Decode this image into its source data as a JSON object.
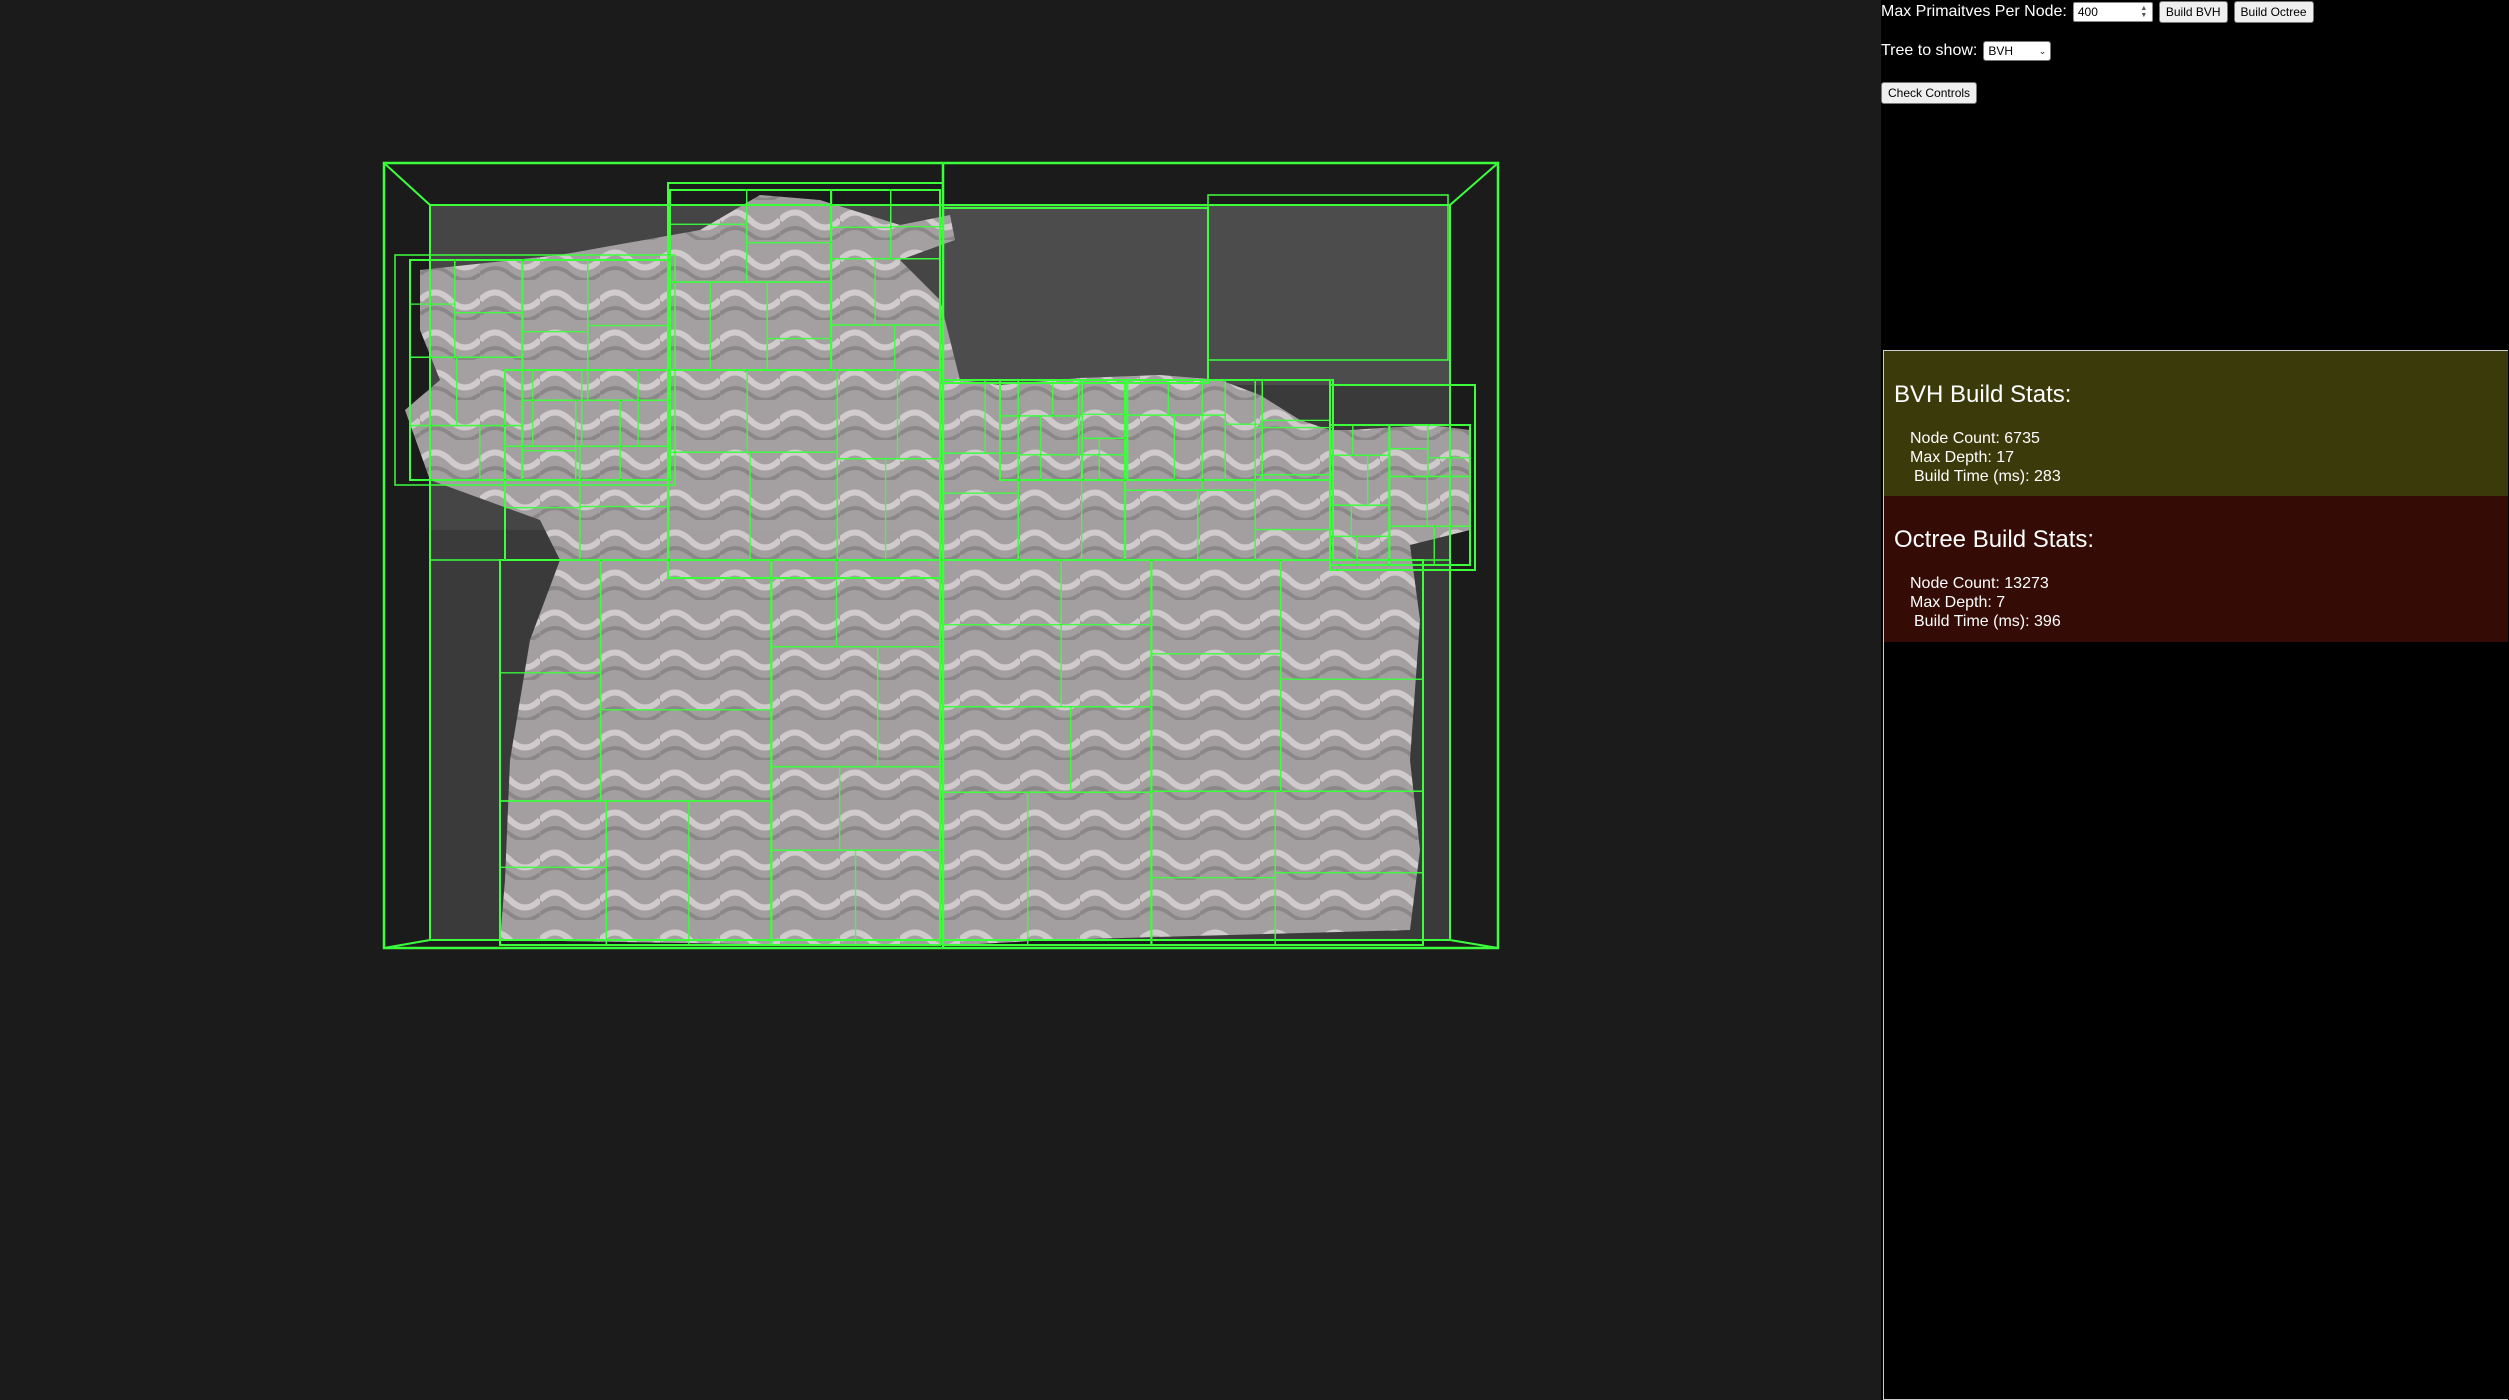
{
  "controls": {
    "max_prims_label": "Max Primaitves Per Node:",
    "max_prims_value": "400",
    "build_bvh_label": "Build BVH",
    "build_octree_label": "Build Octree",
    "tree_label": "Tree to show:",
    "tree_selected": "BVH",
    "check_controls_label": "Check Controls"
  },
  "bvh_stats": {
    "title": "BVH Build Stats:",
    "node_count": "Node Count: 6735",
    "max_depth": "Max Depth: 17",
    "build_time": "Build Time (ms): 283"
  },
  "octree_stats": {
    "title": "Octree Build Stats:",
    "node_count": "Node Count: 13273",
    "max_depth": "Max Depth: 7",
    "build_time": "Build Time (ms): 396"
  },
  "colors": {
    "viewport_bg": "#1b1b1b",
    "wire": "#3cff3c",
    "mesh": "#b9b2b4",
    "bvh_panel": "#3b3a0a",
    "octree_panel": "#340b05"
  },
  "icons": {
    "spin": "spinner-arrows-icon",
    "dropdown": "chevron-down-icon"
  }
}
